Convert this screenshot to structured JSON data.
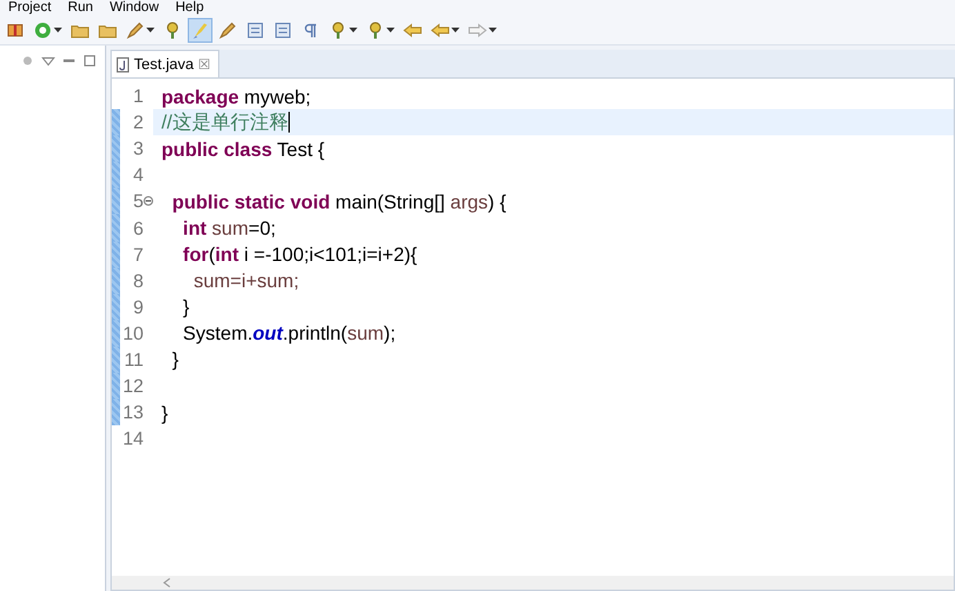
{
  "menu_bar": [
    "Project",
    "Run",
    "Window",
    "Help"
  ],
  "toolbar": [
    {
      "kind": "box",
      "selected": false
    },
    {
      "kind": "circle",
      "dropdown": true,
      "selected": false
    },
    {
      "kind": "folder",
      "selected": false
    },
    {
      "kind": "folder",
      "selected": false
    },
    {
      "kind": "pen",
      "dropdown": true,
      "selected": false
    },
    {
      "kind": "pin",
      "selected": false
    },
    {
      "kind": "brush",
      "selected": true
    },
    {
      "kind": "pen",
      "selected": false
    },
    {
      "kind": "doc",
      "selected": false
    },
    {
      "kind": "doc",
      "selected": false
    },
    {
      "kind": "pilcrow",
      "selected": false
    },
    {
      "kind": "pin",
      "dropdown": true,
      "selected": false
    },
    {
      "kind": "pin",
      "dropdown": true,
      "selected": false
    },
    {
      "kind": "back",
      "selected": false
    },
    {
      "kind": "back",
      "dropdown": true,
      "selected": false
    },
    {
      "kind": "forward",
      "dropdown": true,
      "selected": false
    }
  ],
  "editor": {
    "tab": {
      "label": "Test.java",
      "close": "☒",
      "selected": true
    },
    "lines": [
      {
        "number": "1",
        "changed": false,
        "tokens": [
          {
            "kind": "keyword",
            "text": "package"
          },
          {
            "kind": "plain",
            "text": " myweb;"
          }
        ]
      },
      {
        "number": "2",
        "changed": true,
        "current": true,
        "tokens": [
          {
            "kind": "comment",
            "text": "//这是单行注释"
          }
        ]
      },
      {
        "number": "3",
        "changed": true,
        "tokens": [
          {
            "kind": "keyword",
            "text": "public class"
          },
          {
            "kind": "plain",
            "text": " Test {"
          }
        ]
      },
      {
        "number": "4",
        "changed": true
      },
      {
        "number": "5",
        "changed": true,
        "fold": true,
        "tokens": [
          {
            "kind": "keyword",
            "text": "  public static void"
          },
          {
            "kind": "plain",
            "text": " main(String[] "
          },
          {
            "kind": "variable",
            "text": "args"
          },
          {
            "kind": "plain",
            "text": ") {"
          }
        ]
      },
      {
        "number": "6",
        "changed": true,
        "tokens": [
          {
            "kind": "keyword",
            "text": "    int"
          },
          {
            "kind": "variable",
            "text": " sum"
          },
          {
            "kind": "plain",
            "text": "=0;"
          }
        ]
      },
      {
        "number": "7",
        "changed": true,
        "tokens": [
          {
            "kind": "keyword",
            "text": "    for"
          },
          {
            "kind": "plain",
            "text": "("
          },
          {
            "kind": "keyword",
            "text": "int"
          },
          {
            "kind": "plain",
            "text": " i =-100;i<101;i=i+2){"
          }
        ]
      },
      {
        "number": "8",
        "changed": true,
        "tokens": [
          {
            "kind": "variable",
            "text": "      sum=i+sum;"
          }
        ]
      },
      {
        "number": "9",
        "changed": true,
        "tokens": [
          {
            "kind": "plain",
            "text": "    }"
          }
        ]
      },
      {
        "number": "10",
        "changed": true,
        "tokens": [
          {
            "kind": "plain",
            "text": "    System."
          },
          {
            "kind": "static",
            "text": "out"
          },
          {
            "kind": "plain",
            "text": ".println("
          },
          {
            "kind": "variable",
            "text": "sum"
          },
          {
            "kind": "plain",
            "text": ");"
          }
        ]
      },
      {
        "number": "11",
        "changed": true,
        "tokens": [
          {
            "kind": "plain",
            "text": "  }"
          }
        ]
      },
      {
        "number": "12",
        "changed": true
      },
      {
        "number": "13",
        "changed": true,
        "tokens": [
          {
            "kind": "plain",
            "text": "}"
          }
        ]
      },
      {
        "number": "14",
        "changed": false
      }
    ]
  }
}
